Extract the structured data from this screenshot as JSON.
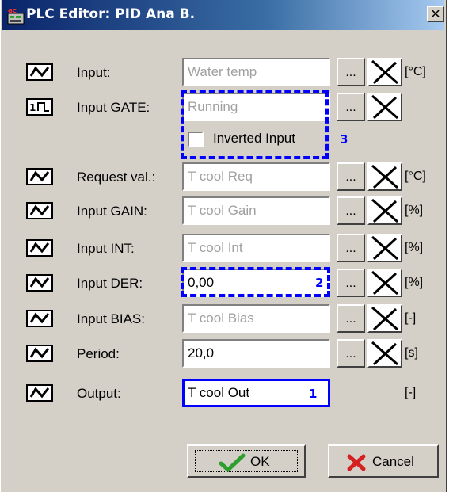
{
  "window": {
    "title": "PLC Editor: PID Ana B.",
    "close_glyph": "✕",
    "app_icon": "gc-plc-icon"
  },
  "rows": [
    {
      "label": "Input:",
      "value": "Water temp",
      "unit": "[°C]",
      "signal_icon": "analog-signal-icon"
    },
    {
      "label": "Input GATE:",
      "value": "Running",
      "unit": "",
      "signal_icon": "binary-signal-icon"
    },
    {
      "label": "Request val.:",
      "value": "T cool Req",
      "unit": "[°C]",
      "signal_icon": "analog-signal-icon"
    },
    {
      "label": "Input GAIN:",
      "value": "T cool Gain",
      "unit": "[%]",
      "signal_icon": "analog-signal-icon"
    },
    {
      "label": "Input INT:",
      "value": "T cool Int",
      "unit": "[%]",
      "signal_icon": "analog-signal-icon"
    },
    {
      "label": "Input DER:",
      "value": "0,00",
      "unit": "[%]",
      "signal_icon": "analog-signal-icon"
    },
    {
      "label": "Input BIAS:",
      "value": "T cool Bias",
      "unit": "[-]",
      "signal_icon": "analog-signal-icon"
    },
    {
      "label": "Period:",
      "value": "20,0",
      "unit": "[s]",
      "signal_icon": "analog-signal-icon"
    },
    {
      "label": "Output:",
      "value": "T cool Out",
      "unit": "[-]",
      "signal_icon": "analog-signal-icon"
    }
  ],
  "inverted_input": {
    "label": "Inverted Input",
    "checked": false
  },
  "dots_label": "...",
  "callouts": {
    "output": "1",
    "der": "2",
    "gate": "3"
  },
  "buttons": {
    "ok": "OK",
    "cancel": "Cancel"
  },
  "colors": {
    "highlight": "#0000ff",
    "ok_check": "#2e9e2e",
    "cancel_x": "#d42020"
  }
}
